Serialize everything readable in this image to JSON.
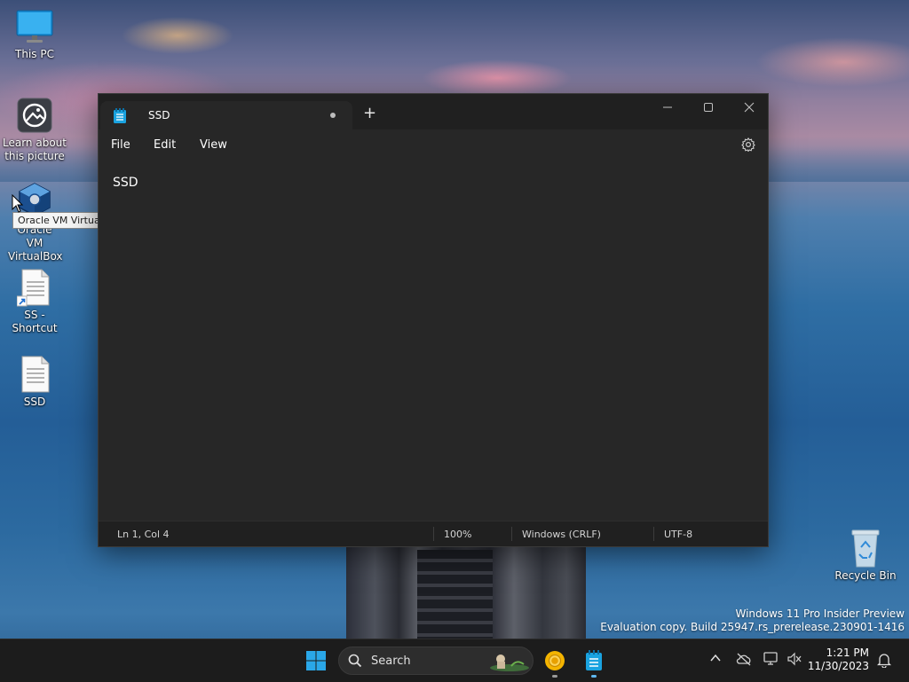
{
  "desktop": {
    "icons": [
      {
        "label": "This PC"
      },
      {
        "label": "Learn about this picture"
      },
      {
        "label": "Oracle VM VirtualBox"
      },
      {
        "label": "SS - Shortcut"
      },
      {
        "label": "SSD"
      },
      {
        "label": "Recycle Bin"
      }
    ],
    "tooltip": "Oracle VM VirtualBox",
    "watermark_line1": "Windows 11 Pro Insider Preview",
    "watermark_line2": "Evaluation copy. Build 25947.rs_prerelease.230901-1416"
  },
  "notepad": {
    "tab_title": "SSD",
    "new_tab_label": "+",
    "menu": {
      "file": "File",
      "edit": "Edit",
      "view": "View"
    },
    "content": "SSD",
    "status": {
      "position": "Ln 1, Col 4",
      "zoom": "100%",
      "line_ending": "Windows (CRLF)",
      "encoding": "UTF-8"
    }
  },
  "taskbar": {
    "search_label": "Search",
    "time": "1:21 PM",
    "date": "11/30/2023"
  },
  "colors": {
    "window_bg": "#272727",
    "titlebar_bg": "#202020",
    "taskbar_bg": "#1c1c1c",
    "accent": "#0f9bd7"
  }
}
